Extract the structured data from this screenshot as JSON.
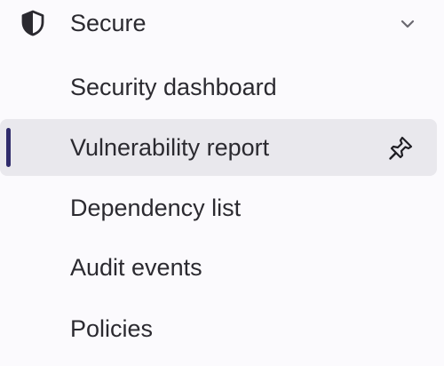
{
  "section": {
    "label": "Secure",
    "icon": "shield-icon",
    "expand_icon": "chevron-down-icon",
    "expanded": true
  },
  "items": [
    {
      "label": "Security dashboard",
      "active": false
    },
    {
      "label": "Vulnerability report",
      "active": true,
      "pinned_icon": "pin-icon"
    },
    {
      "label": "Dependency list",
      "active": false
    },
    {
      "label": "Audit events",
      "active": false
    },
    {
      "label": "Policies",
      "active": false
    }
  ],
  "colors": {
    "background": "#fbfafd",
    "active_background": "#e9e8ed",
    "active_indicator": "#2f2b6b",
    "text": "#2b2a30"
  }
}
